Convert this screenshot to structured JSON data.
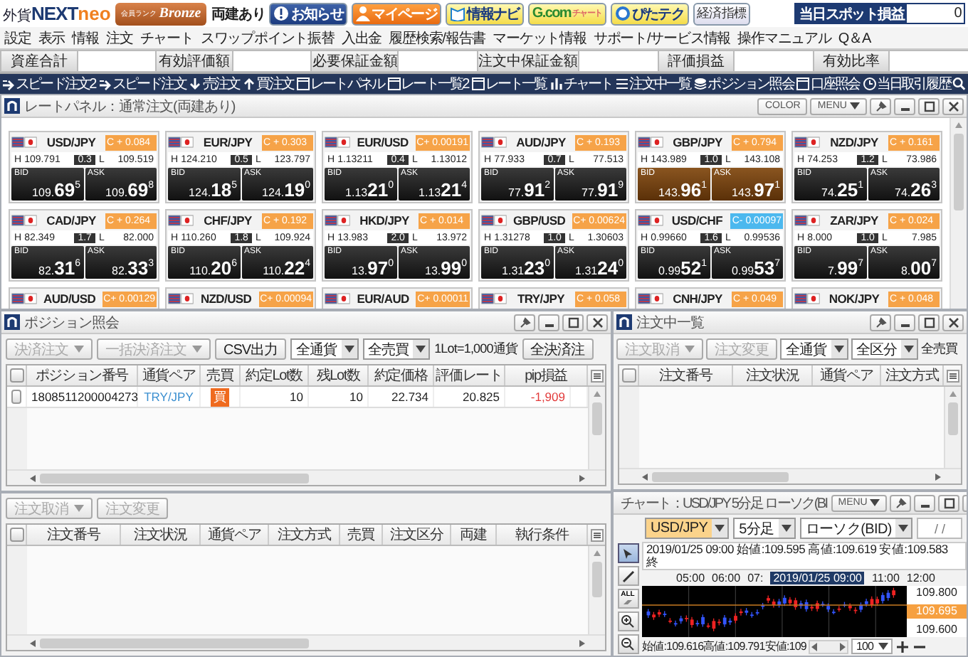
{
  "header": {
    "logo_prefix": "外貨",
    "logo_main": "NEXT",
    "logo_suffix": "neo",
    "rank_label": "会員ランク",
    "rank": "Bronze",
    "hedge_status": "両建あり",
    "buttons": [
      {
        "label": "お知らせ",
        "kind": "notice"
      },
      {
        "label": "マイページ",
        "kind": "mypage"
      },
      {
        "label": "情報ナビ",
        "kind": "navi"
      },
      {
        "label": "G.com",
        "sub": "チャート",
        "kind": "gcom"
      },
      {
        "label": "ぴたテク",
        "kind": "pita"
      },
      {
        "label": "経済指標",
        "kind": "plain"
      }
    ],
    "spot_pl_label": "当日スポット損益",
    "spot_pl_value": "0"
  },
  "menu": [
    "設定",
    "表示",
    "情報",
    "注文",
    "チャート",
    "スワップポイント振替",
    "入出金",
    "履歴検索/報告書",
    "マーケット情報",
    "サポート/サービス情報",
    "操作マニュアル",
    "Q＆A"
  ],
  "summary": [
    "資産合計",
    "有効評価額",
    "必要保証金額",
    "注文中保証金額",
    "評価損益",
    "有効比率"
  ],
  "toolbar": [
    {
      "label": "スピード注文2",
      "kind": "speed"
    },
    {
      "label": "スピード注文",
      "kind": "speed"
    },
    {
      "label": "売注文",
      "kind": "sell"
    },
    {
      "label": "買注文",
      "kind": "buy"
    },
    {
      "label": "レートパネル",
      "kind": "window"
    },
    {
      "label": "レート一覧2",
      "kind": "window"
    },
    {
      "label": "レート一覧",
      "kind": "window"
    },
    {
      "label": "チャート",
      "kind": "chart"
    },
    {
      "label": "注文中一覧",
      "kind": "list"
    },
    {
      "label": "ポジション照会",
      "kind": "stack"
    },
    {
      "label": "口座照会",
      "kind": "window"
    },
    {
      "label": "当日取引履歴",
      "kind": "history"
    }
  ],
  "rate_panel": {
    "title": "レートパネル：通常注文(両建あり)",
    "color_button": "COLOR",
    "menu_button": "MENU",
    "tiles": [
      {
        "pair": "USD/JPY",
        "change": "C + 0.084",
        "falling": false,
        "highlighted": false,
        "h": "H",
        "high": "109.791",
        "spread": "0.3",
        "l": "L",
        "low": "109.519",
        "bid_label": "BID",
        "bid": {
          "pre": "109.",
          "big": "69",
          "pip": "5"
        },
        "ask_label": "ASK",
        "ask": {
          "pre": "109.",
          "big": "69",
          "pip": "8"
        }
      },
      {
        "pair": "EUR/JPY",
        "change": "C + 0.303",
        "falling": false,
        "highlighted": false,
        "h": "H",
        "high": "124.210",
        "spread": "0.5",
        "l": "L",
        "low": "123.797",
        "bid_label": "BID",
        "bid": {
          "pre": "124.",
          "big": "18",
          "pip": "5"
        },
        "ask_label": "ASK",
        "ask": {
          "pre": "124.",
          "big": "19",
          "pip": "0"
        }
      },
      {
        "pair": "EUR/USD",
        "change": "C+ 0.00191",
        "falling": false,
        "highlighted": false,
        "h": "H",
        "high": "1.13211",
        "spread": "0.4",
        "l": "L",
        "low": "1.13012",
        "bid_label": "BID",
        "bid": {
          "pre": "1.13",
          "big": "21",
          "pip": "0"
        },
        "ask_label": "ASK",
        "ask": {
          "pre": "1.13",
          "big": "21",
          "pip": "4"
        }
      },
      {
        "pair": "AUD/JPY",
        "change": "C + 0.193",
        "falling": false,
        "highlighted": false,
        "h": "H",
        "high": "77.933",
        "spread": "0.7",
        "l": "L",
        "low": "77.513",
        "bid_label": "BID",
        "bid": {
          "pre": "77.",
          "big": "91",
          "pip": "2"
        },
        "ask_label": "ASK",
        "ask": {
          "pre": "77.",
          "big": "91",
          "pip": "9"
        }
      },
      {
        "pair": "GBP/JPY",
        "change": "C + 0.794",
        "falling": false,
        "highlighted": true,
        "h": "H",
        "high": "143.989",
        "spread": "1.0",
        "l": "L",
        "low": "143.108",
        "bid_label": "BID",
        "bid": {
          "pre": "143.",
          "big": "96",
          "pip": "1"
        },
        "ask_label": "ASK",
        "ask": {
          "pre": "143.",
          "big": "97",
          "pip": "1"
        }
      },
      {
        "pair": "NZD/JPY",
        "change": "C + 0.161",
        "falling": false,
        "highlighted": false,
        "h": "H",
        "high": "74.253",
        "spread": "1.2",
        "l": "L",
        "low": "73.986",
        "bid_label": "BID",
        "bid": {
          "pre": "74.",
          "big": "25",
          "pip": "1"
        },
        "ask_label": "ASK",
        "ask": {
          "pre": "74.",
          "big": "26",
          "pip": "3"
        }
      },
      {
        "pair": "CAD/JPY",
        "change": "C + 0.264",
        "falling": false,
        "highlighted": false,
        "h": "H",
        "high": "82.349",
        "spread": "1.7",
        "l": "L",
        "low": "82.000",
        "bid_label": "BID",
        "bid": {
          "pre": "82.",
          "big": "31",
          "pip": "6"
        },
        "ask_label": "ASK",
        "ask": {
          "pre": "82.",
          "big": "33",
          "pip": "3"
        }
      },
      {
        "pair": "CHF/JPY",
        "change": "C + 0.192",
        "falling": false,
        "highlighted": false,
        "h": "H",
        "high": "110.260",
        "spread": "1.8",
        "l": "L",
        "low": "109.924",
        "bid_label": "BID",
        "bid": {
          "pre": "110.",
          "big": "20",
          "pip": "6"
        },
        "ask_label": "ASK",
        "ask": {
          "pre": "110.",
          "big": "22",
          "pip": "4"
        }
      },
      {
        "pair": "HKD/JPY",
        "change": "C + 0.014",
        "falling": false,
        "highlighted": false,
        "h": "H",
        "high": "13.983",
        "spread": "2.0",
        "l": "L",
        "low": "13.972",
        "bid_label": "BID",
        "bid": {
          "pre": "13.",
          "big": "97",
          "pip": "0"
        },
        "ask_label": "ASK",
        "ask": {
          "pre": "13.",
          "big": "99",
          "pip": "0"
        }
      },
      {
        "pair": "GBP/USD",
        "change": "C+ 0.00624",
        "falling": false,
        "highlighted": false,
        "h": "H",
        "high": "1.31278",
        "spread": "1.0",
        "l": "L",
        "low": "1.30603",
        "bid_label": "BID",
        "bid": {
          "pre": "1.31",
          "big": "23",
          "pip": "0"
        },
        "ask_label": "ASK",
        "ask": {
          "pre": "1.31",
          "big": "24",
          "pip": "0"
        }
      },
      {
        "pair": "USD/CHF",
        "change": "C- 0.00097",
        "falling": true,
        "highlighted": false,
        "h": "H",
        "high": "0.99660",
        "spread": "1.6",
        "l": "L",
        "low": "0.99536",
        "bid_label": "BID",
        "bid": {
          "pre": "0.99",
          "big": "52",
          "pip": "1"
        },
        "ask_label": "ASK",
        "ask": {
          "pre": "0.99",
          "big": "53",
          "pip": "7"
        }
      },
      {
        "pair": "ZAR/JPY",
        "change": "C + 0.024",
        "falling": false,
        "highlighted": false,
        "h": "H",
        "high": "8.000",
        "spread": "1.0",
        "l": "L",
        "low": "7.985",
        "bid_label": "BID",
        "bid": {
          "pre": "7.",
          "big": "99",
          "pip": "7"
        },
        "ask_label": "ASK",
        "ask": {
          "pre": "8.",
          "big": "00",
          "pip": "7"
        }
      },
      {
        "pair": "AUD/USD",
        "change": "C+ 0.00129",
        "falling": false
      },
      {
        "pair": "NZD/USD",
        "change": "C+ 0.00094",
        "falling": false
      },
      {
        "pair": "EUR/AUD",
        "change": "C+ 0.00011",
        "falling": false
      },
      {
        "pair": "TRY/JPY",
        "change": "C + 0.058",
        "falling": false
      },
      {
        "pair": "CNH/JPY",
        "change": "C + 0.049",
        "falling": false
      },
      {
        "pair": "NOK/JPY",
        "change": "C + 0.048",
        "falling": false
      }
    ]
  },
  "positions": {
    "title": "ポジション照会",
    "controls": [
      {
        "label": "決済注文",
        "kind": "dropdown",
        "disabled": true
      },
      {
        "label": "一括決済注文",
        "kind": "dropdown",
        "disabled": true
      },
      {
        "label": "CSV出力",
        "kind": "button",
        "disabled": false
      },
      {
        "label": "全通貨",
        "kind": "select"
      },
      {
        "label": "全売買",
        "kind": "select"
      },
      {
        "label": "1Lot=1,000通貨",
        "kind": "text"
      },
      {
        "label": "全決済注",
        "kind": "button",
        "disabled": false
      }
    ],
    "select_all_checked": false,
    "columns": [
      "ポジション番号",
      "通貨ペア",
      "売買",
      "約定Lot数",
      "残Lot数",
      "約定価格",
      "評価レート",
      "pip損益"
    ],
    "rows": [
      {
        "checked": false,
        "position_no": "1808511200004273",
        "pair": "TRY/JPY",
        "side": "買",
        "lots": "10",
        "remaining": "10",
        "price": "22.734",
        "rate": "20.825",
        "pips": "-1,909",
        "loss": true
      }
    ]
  },
  "orders_lower": {
    "controls": [
      {
        "label": "注文取消",
        "kind": "dropdown",
        "disabled": true
      },
      {
        "label": "注文変更",
        "kind": "button",
        "disabled": true
      }
    ],
    "select_all_checked": false,
    "columns": [
      "注文番号",
      "注文状況",
      "通貨ペア",
      "注文方式",
      "売買",
      "注文区分",
      "両建",
      "執行条件"
    ]
  },
  "orders": {
    "title": "注文中一覧",
    "controls": [
      {
        "label": "注文取消",
        "kind": "dropdown",
        "disabled": true
      },
      {
        "label": "注文変更",
        "kind": "button",
        "disabled": true
      },
      {
        "label": "全通貨",
        "kind": "select"
      },
      {
        "label": "全区分",
        "kind": "select"
      },
      {
        "label": "全売買",
        "kind": "text"
      }
    ],
    "select_all_checked": false,
    "columns": [
      "注文番号",
      "注文状況",
      "通貨ペア",
      "注文方式"
    ]
  },
  "chart": {
    "title": "チャート：USD/JPY 5分足 ローソク(BI",
    "menu_button": "MENU",
    "controls": [
      {
        "label": "USD/JPY",
        "kind": "select",
        "highlighted": true
      },
      {
        "label": "5分足",
        "kind": "select",
        "highlighted": false
      },
      {
        "label": "ローソク(BID)",
        "kind": "select",
        "highlighted": false
      },
      {
        "label": "/ /",
        "kind": "date"
      }
    ],
    "tools": [
      {
        "kind": "cursor",
        "selected": true
      },
      {
        "kind": "pen",
        "selected": false
      },
      {
        "kind": "clear",
        "label": "ALL",
        "selected": false
      },
      {
        "kind": "zoom-in",
        "selected": false
      },
      {
        "kind": "zoom-out",
        "selected": false
      }
    ],
    "info": "2019/01/25 09:00 始値:109.595 高値:109.619 安値:109.583 終",
    "time_labels_before": [
      "05:00",
      "06:00",
      "07:"
    ],
    "cursor_time": "2019/01/25 09:00",
    "time_labels_after": [
      "11:00",
      "12:00"
    ],
    "price_labels": [
      {
        "text": "109.800",
        "current": false
      },
      {
        "text": "109.695",
        "current": true
      },
      {
        "text": "109.600",
        "current": false
      }
    ],
    "footer_info": "始値:109.616高値:109.791安値:109",
    "zoom_value": "100"
  }
}
